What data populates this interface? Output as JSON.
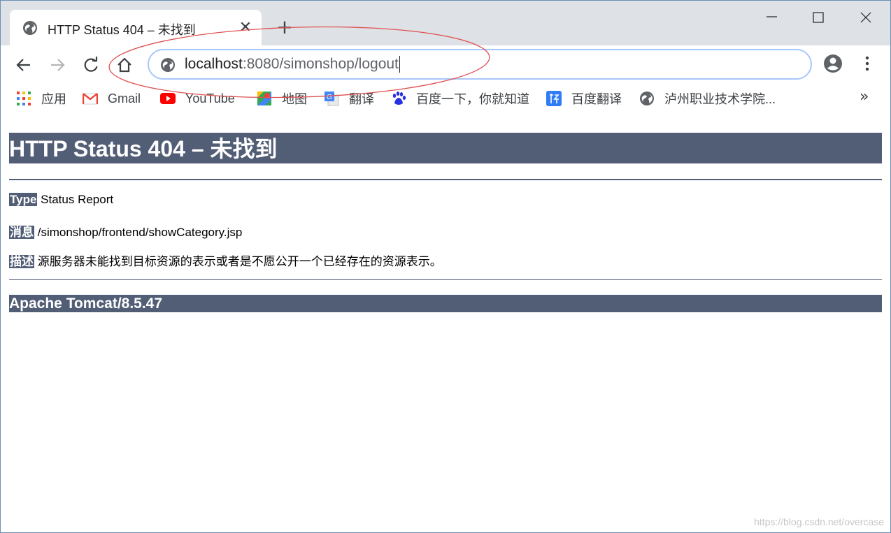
{
  "browser": {
    "tab": {
      "title": "HTTP Status 404 – 未找到",
      "close_symbol": "✕"
    },
    "new_tab_symbol": "+",
    "address_bar": {
      "host": "localhost",
      "rest": ":8080/simonshop/logout"
    },
    "bookmarks": [
      {
        "label": "应用",
        "icon": "apps-grid-icon"
      },
      {
        "label": "Gmail",
        "icon": "gmail-icon"
      },
      {
        "label": "YouTube",
        "icon": "youtube-icon"
      },
      {
        "label": "地图",
        "icon": "maps-icon"
      },
      {
        "label": "翻译",
        "icon": "translate-icon"
      },
      {
        "label": "百度一下，你就知道",
        "icon": "baidu-icon"
      },
      {
        "label": "百度翻译",
        "icon": "baidu-translate-icon"
      },
      {
        "label": "泸州职业技术学院...",
        "icon": "globe-icon"
      }
    ],
    "more_bookmarks_symbol": "»"
  },
  "page": {
    "heading": "HTTP Status 404 – 未找到",
    "type_label": "Type",
    "type_value": "Status Report",
    "message_label": "消息",
    "message_value": "/simonshop/frontend/showCategory.jsp",
    "description_label": "描述",
    "description_value": "源服务器未能找到目标资源的表示或者是不愿公开一个已经存在的资源表示。",
    "footer": "Apache Tomcat/8.5.47"
  },
  "watermark": "https://blog.csdn.net/overcase",
  "colors": {
    "tomcat_header": "#525d76",
    "tabstrip": "#dee1e6",
    "omnibox_border": "#a8c7fa",
    "annotation": "#e05050"
  }
}
